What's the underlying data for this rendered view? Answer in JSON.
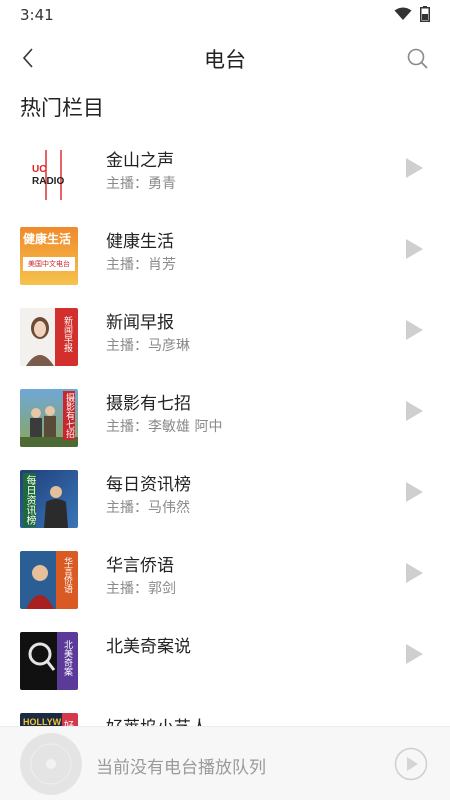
{
  "status": {
    "time": "3:41"
  },
  "header": {
    "title": "电台"
  },
  "section": {
    "title": "热门栏目"
  },
  "stations": [
    {
      "title": "金山之声",
      "host": "主播：勇青",
      "cover_text": "UC RADIO",
      "cover": "uc-radio"
    },
    {
      "title": "健康生活",
      "host": "主播：肖芳",
      "cover_text": "健康生活",
      "cover_sub": "美国中文电台",
      "cover": "health"
    },
    {
      "title": "新闻早报",
      "host": "主播：马彦琳",
      "cover_text": "新闻早报",
      "cover": "news"
    },
    {
      "title": "摄影有七招",
      "host": "主播：李敏雄  阿中",
      "cover_text": "摄影有七招",
      "cover": "photo"
    },
    {
      "title": "每日资讯榜",
      "host": "主播：马伟然",
      "cover_text": "每日资讯榜",
      "cover": "daily"
    },
    {
      "title": "华言侨语",
      "host": "主播：郭剑",
      "cover_text": "华言侨语",
      "cover": "chinese"
    },
    {
      "title": "北美奇案说",
      "host": "",
      "cover_text": "北美奇案",
      "cover": "cases"
    },
    {
      "title": "好莱坞小艺人",
      "host": "",
      "cover_text": "HOLLYW",
      "cover_side": "好",
      "cover": "hollywood"
    }
  ],
  "player": {
    "empty_text": "当前没有电台播放队列"
  },
  "colors": {
    "play_icon": "#cfcfcf",
    "accent_red": "#c8272d"
  }
}
